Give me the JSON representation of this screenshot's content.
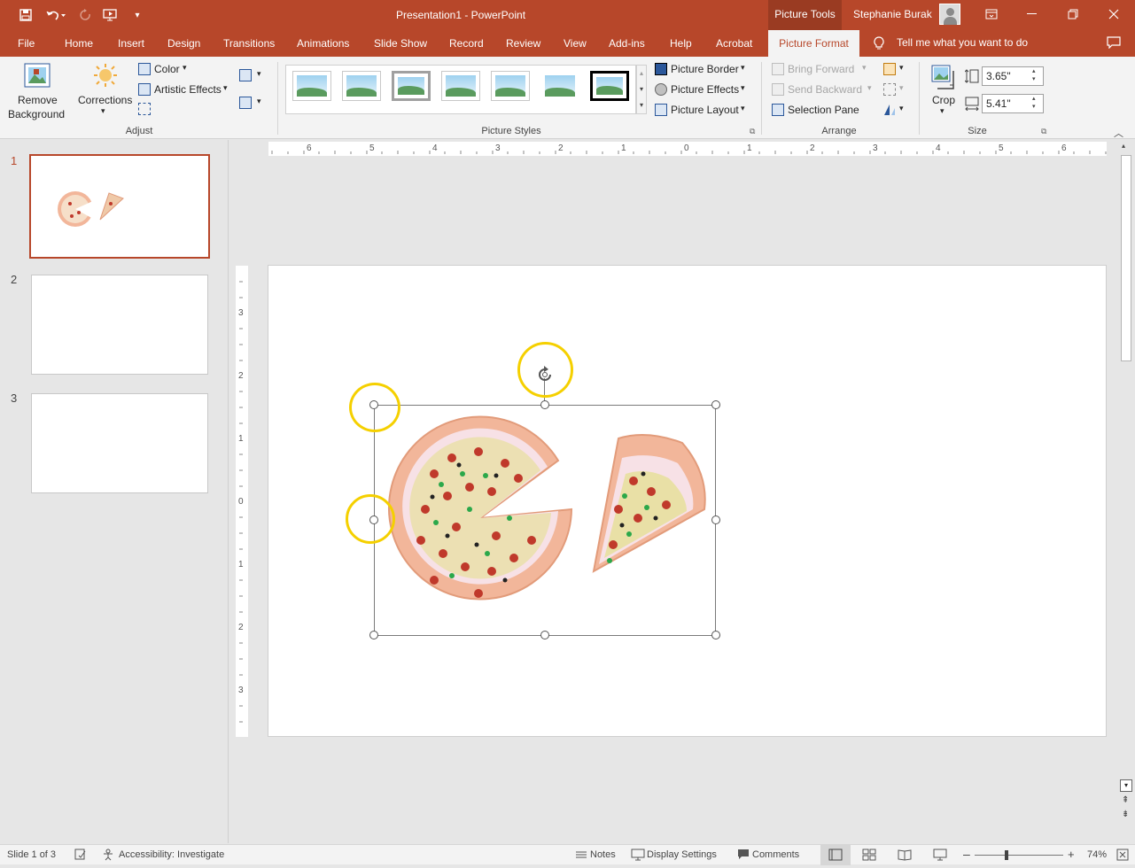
{
  "window": {
    "title": "Presentation1  -  PowerPoint",
    "contextual_tab_group": "Picture Tools",
    "user_name": "Stephanie Burak"
  },
  "tabs": [
    "File",
    "Home",
    "Insert",
    "Design",
    "Transitions",
    "Animations",
    "Slide Show",
    "Record",
    "Review",
    "View",
    "Add-ins",
    "Help",
    "Acrobat",
    "Picture Format"
  ],
  "active_tab": "Picture Format",
  "tell_me": "Tell me what you want to do",
  "ribbon": {
    "adjust": {
      "label": "Adjust",
      "remove_background_line1": "Remove",
      "remove_background_line2": "Background",
      "corrections": "Corrections",
      "color": "Color",
      "artistic_effects": "Artistic Effects"
    },
    "picture_styles": {
      "label": "Picture Styles",
      "picture_border": "Picture Border",
      "picture_effects": "Picture Effects",
      "picture_layout": "Picture Layout"
    },
    "arrange": {
      "label": "Arrange",
      "bring_forward": "Bring Forward",
      "send_backward": "Send Backward",
      "selection_pane": "Selection Pane"
    },
    "size": {
      "label": "Size",
      "crop": "Crop",
      "height": "3.65\"",
      "width": "5.41\""
    }
  },
  "slides": [
    {
      "number": "1"
    },
    {
      "number": "2"
    },
    {
      "number": "3"
    }
  ],
  "ruler": {
    "horizontal_labels": [
      "6",
      "5",
      "4",
      "3",
      "2",
      "1",
      "0",
      "1",
      "2",
      "3",
      "4",
      "5",
      "6"
    ],
    "vertical_labels": [
      "3",
      "2",
      "1",
      "0",
      "1",
      "2",
      "3"
    ]
  },
  "status": {
    "slide_info": "Slide 1 of 3",
    "accessibility": "Accessibility: Investigate",
    "notes": "Notes",
    "display_settings": "Display Settings",
    "comments": "Comments",
    "zoom": "74%"
  },
  "colors": {
    "accent": "#b7472a",
    "highlight": "#f5d000"
  }
}
